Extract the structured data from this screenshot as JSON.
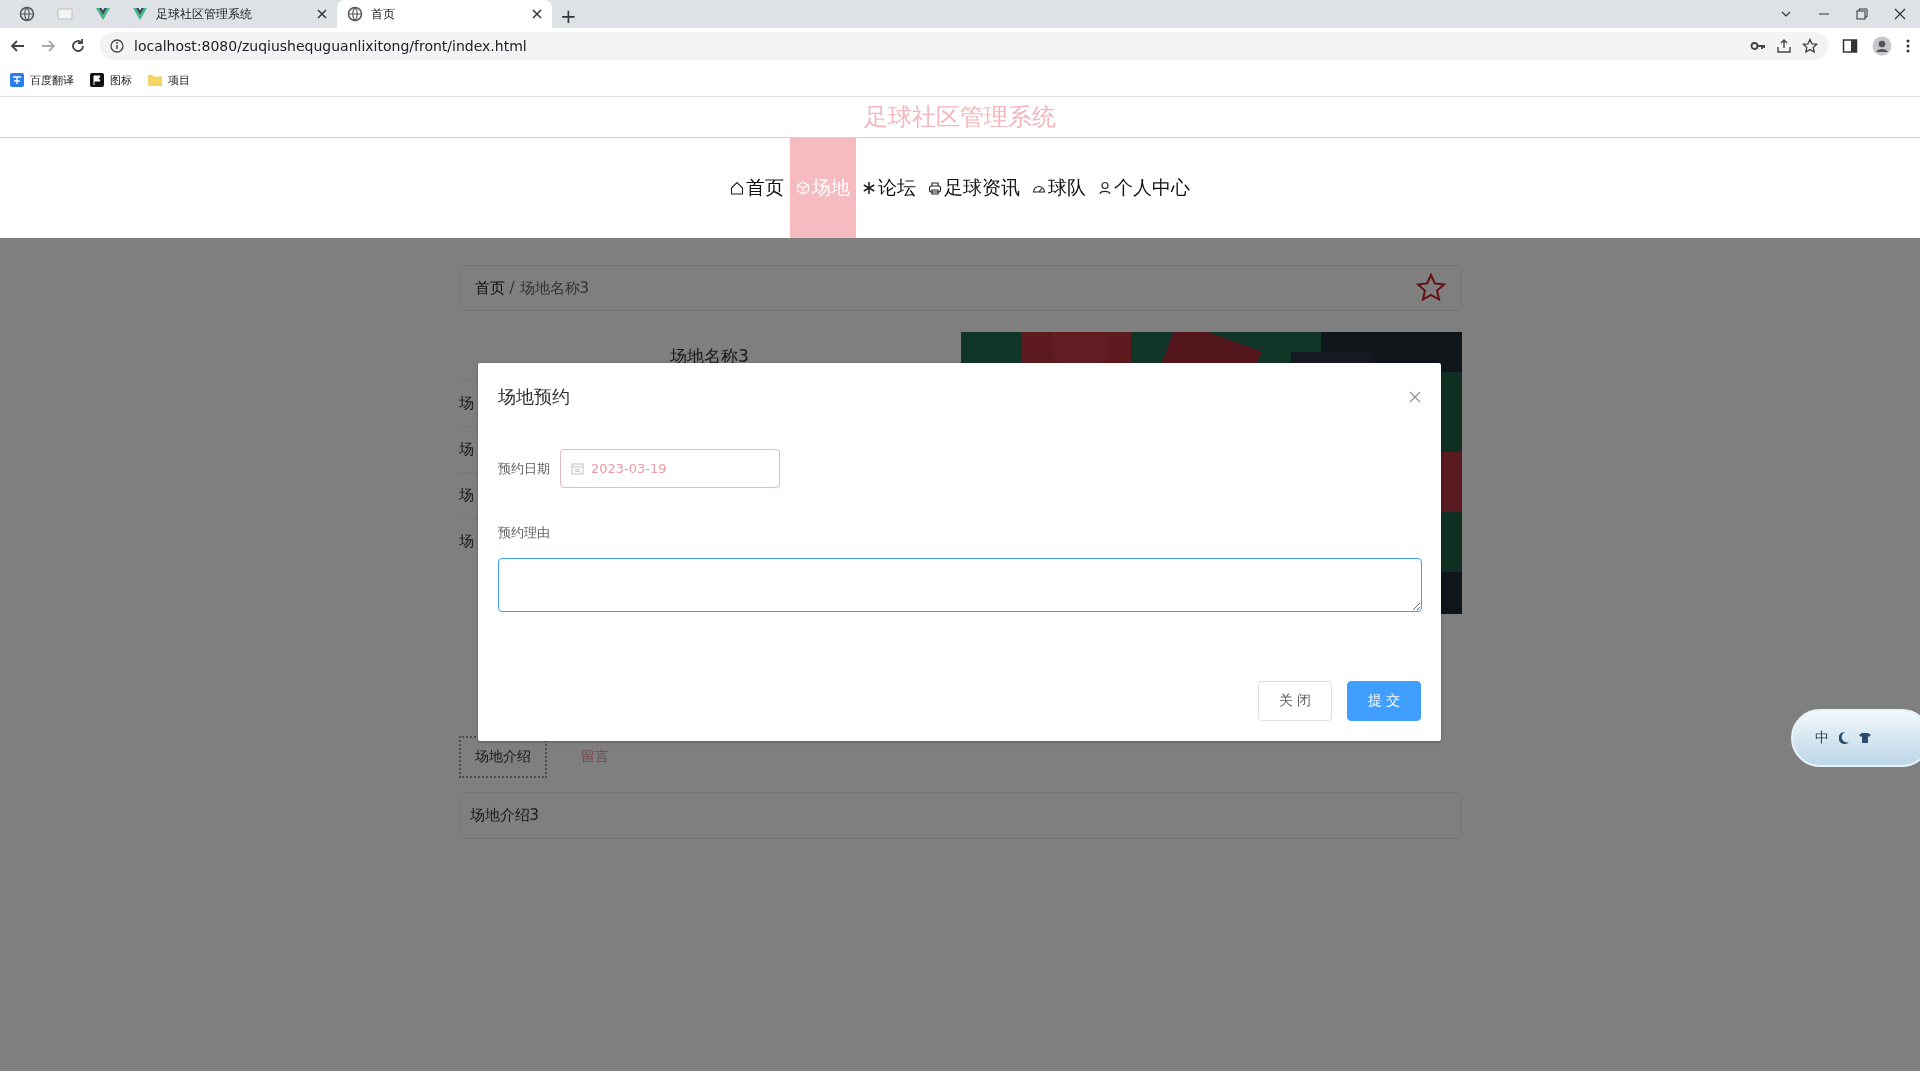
{
  "browser": {
    "tabs": [
      {
        "title": "足球社区管理系统",
        "selected": false
      },
      {
        "title": "首页",
        "selected": true
      }
    ],
    "new_tab": "+",
    "url": "localhost:8080/zuqiushequguanlixitong/front/index.html",
    "bookmarks": [
      "百度翻译",
      "图标",
      "项目"
    ]
  },
  "site": {
    "title": "足球社区管理系统",
    "nav": [
      {
        "label": "首页",
        "selected": false
      },
      {
        "label": "场地",
        "selected": true
      },
      {
        "label": "论坛",
        "selected": false
      },
      {
        "label": "足球资讯",
        "selected": false
      },
      {
        "label": "球队",
        "selected": false
      },
      {
        "label": "个人中心",
        "selected": false
      }
    ]
  },
  "page": {
    "breadcrumb": {
      "items": [
        "首页",
        "场地名称3"
      ],
      "separator": "/"
    },
    "detail": {
      "title": "场地名称3",
      "rows": [
        "场",
        "场",
        "场",
        "场"
      ]
    },
    "tabs": [
      {
        "label": "场地介绍",
        "selected": true
      },
      {
        "label": "留言",
        "selected": false
      }
    ],
    "intro": "场地介绍3"
  },
  "dialog": {
    "title": "场地预约",
    "date": {
      "label": "预约日期",
      "value": "2023-03-19"
    },
    "reason": {
      "label": "预约理由",
      "focused": true
    },
    "buttons": [
      {
        "label": "关闭",
        "kind": "default"
      },
      {
        "label": "提交",
        "kind": "primary"
      }
    ]
  },
  "ime": {
    "label": "中"
  }
}
